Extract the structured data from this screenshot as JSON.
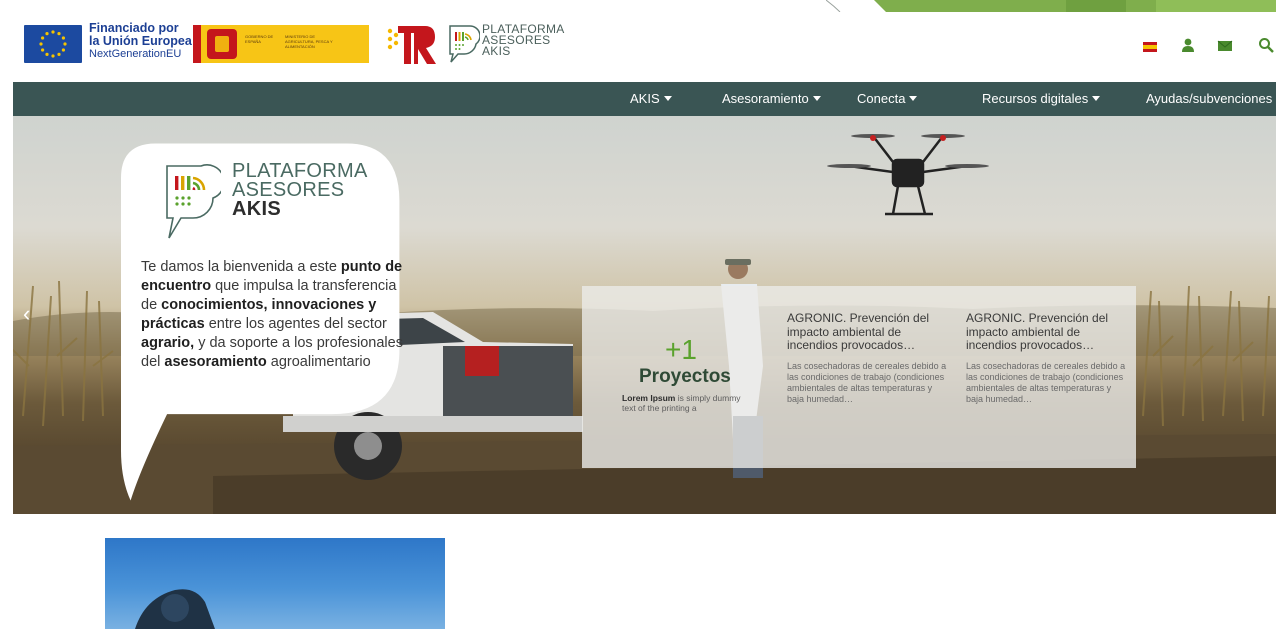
{
  "header": {
    "eu_funding": {
      "line1": "Financiado por",
      "line2": "la Unión Europea",
      "line3": "NextGenerationEU"
    },
    "gobierno_logo": {
      "text_left": "GOBIERNO DE ESPAÑA",
      "text_right": "MINISTERIO DE AGRICULTURA, PESCA Y ALIMENTACIÓN"
    },
    "brand": {
      "line1": "PLATAFORMA",
      "line2": "ASESORES",
      "line3": "AKIS"
    },
    "icons": [
      "spain-flag-icon",
      "user-icon",
      "mail-icon",
      "search-icon"
    ]
  },
  "nav": {
    "items": [
      {
        "label": "AKIS",
        "dropdown": true
      },
      {
        "label": "Asesoramiento",
        "dropdown": true
      },
      {
        "label": "Conecta",
        "dropdown": true
      },
      {
        "label": "Recursos digitales",
        "dropdown": true
      },
      {
        "label": "Ayudas/subvenciones",
        "dropdown": false
      }
    ]
  },
  "hero": {
    "logo": {
      "line1": "PLATAFORMA",
      "line2": "ASESORES",
      "line3": "AKIS"
    },
    "welcome": {
      "p1": "Te damos la bienvenida a este ",
      "b1": "punto de encuentro",
      "p2": " que impulsa la transferencia de ",
      "b2": "conocimientos, innovaciones y prácticas",
      "p3": " entre los agentes del sector ",
      "b3": "agrario,",
      "p4": " y da soporte a los profesionales del ",
      "b4": "asesoramiento",
      "p5": " agroalimentario"
    },
    "stats": {
      "value": "+1",
      "label": "Proyectos",
      "desc_bold": "Lorem Ipsum",
      "desc_rest": " is simply dummy text of the printing a"
    },
    "cards": [
      {
        "title": "AGRONIC. Prevención del impacto ambiental de incendios provocados…",
        "body": "Las cosechadoras de cereales debido a las condiciones de trabajo (condiciones ambientales de altas temperaturas y baja humedad…"
      },
      {
        "title": "AGRONIC. Prevención del impacto ambiental de incendios provocados…",
        "body": "Las cosechadoras de cereales debido a las condiciones de trabajo (condiciones ambientales de altas temperaturas y baja humedad…"
      }
    ]
  },
  "colors": {
    "nav_bg": "#3a5554",
    "accent_green": "#5aa22d",
    "eu_blue": "#1c3f94"
  }
}
